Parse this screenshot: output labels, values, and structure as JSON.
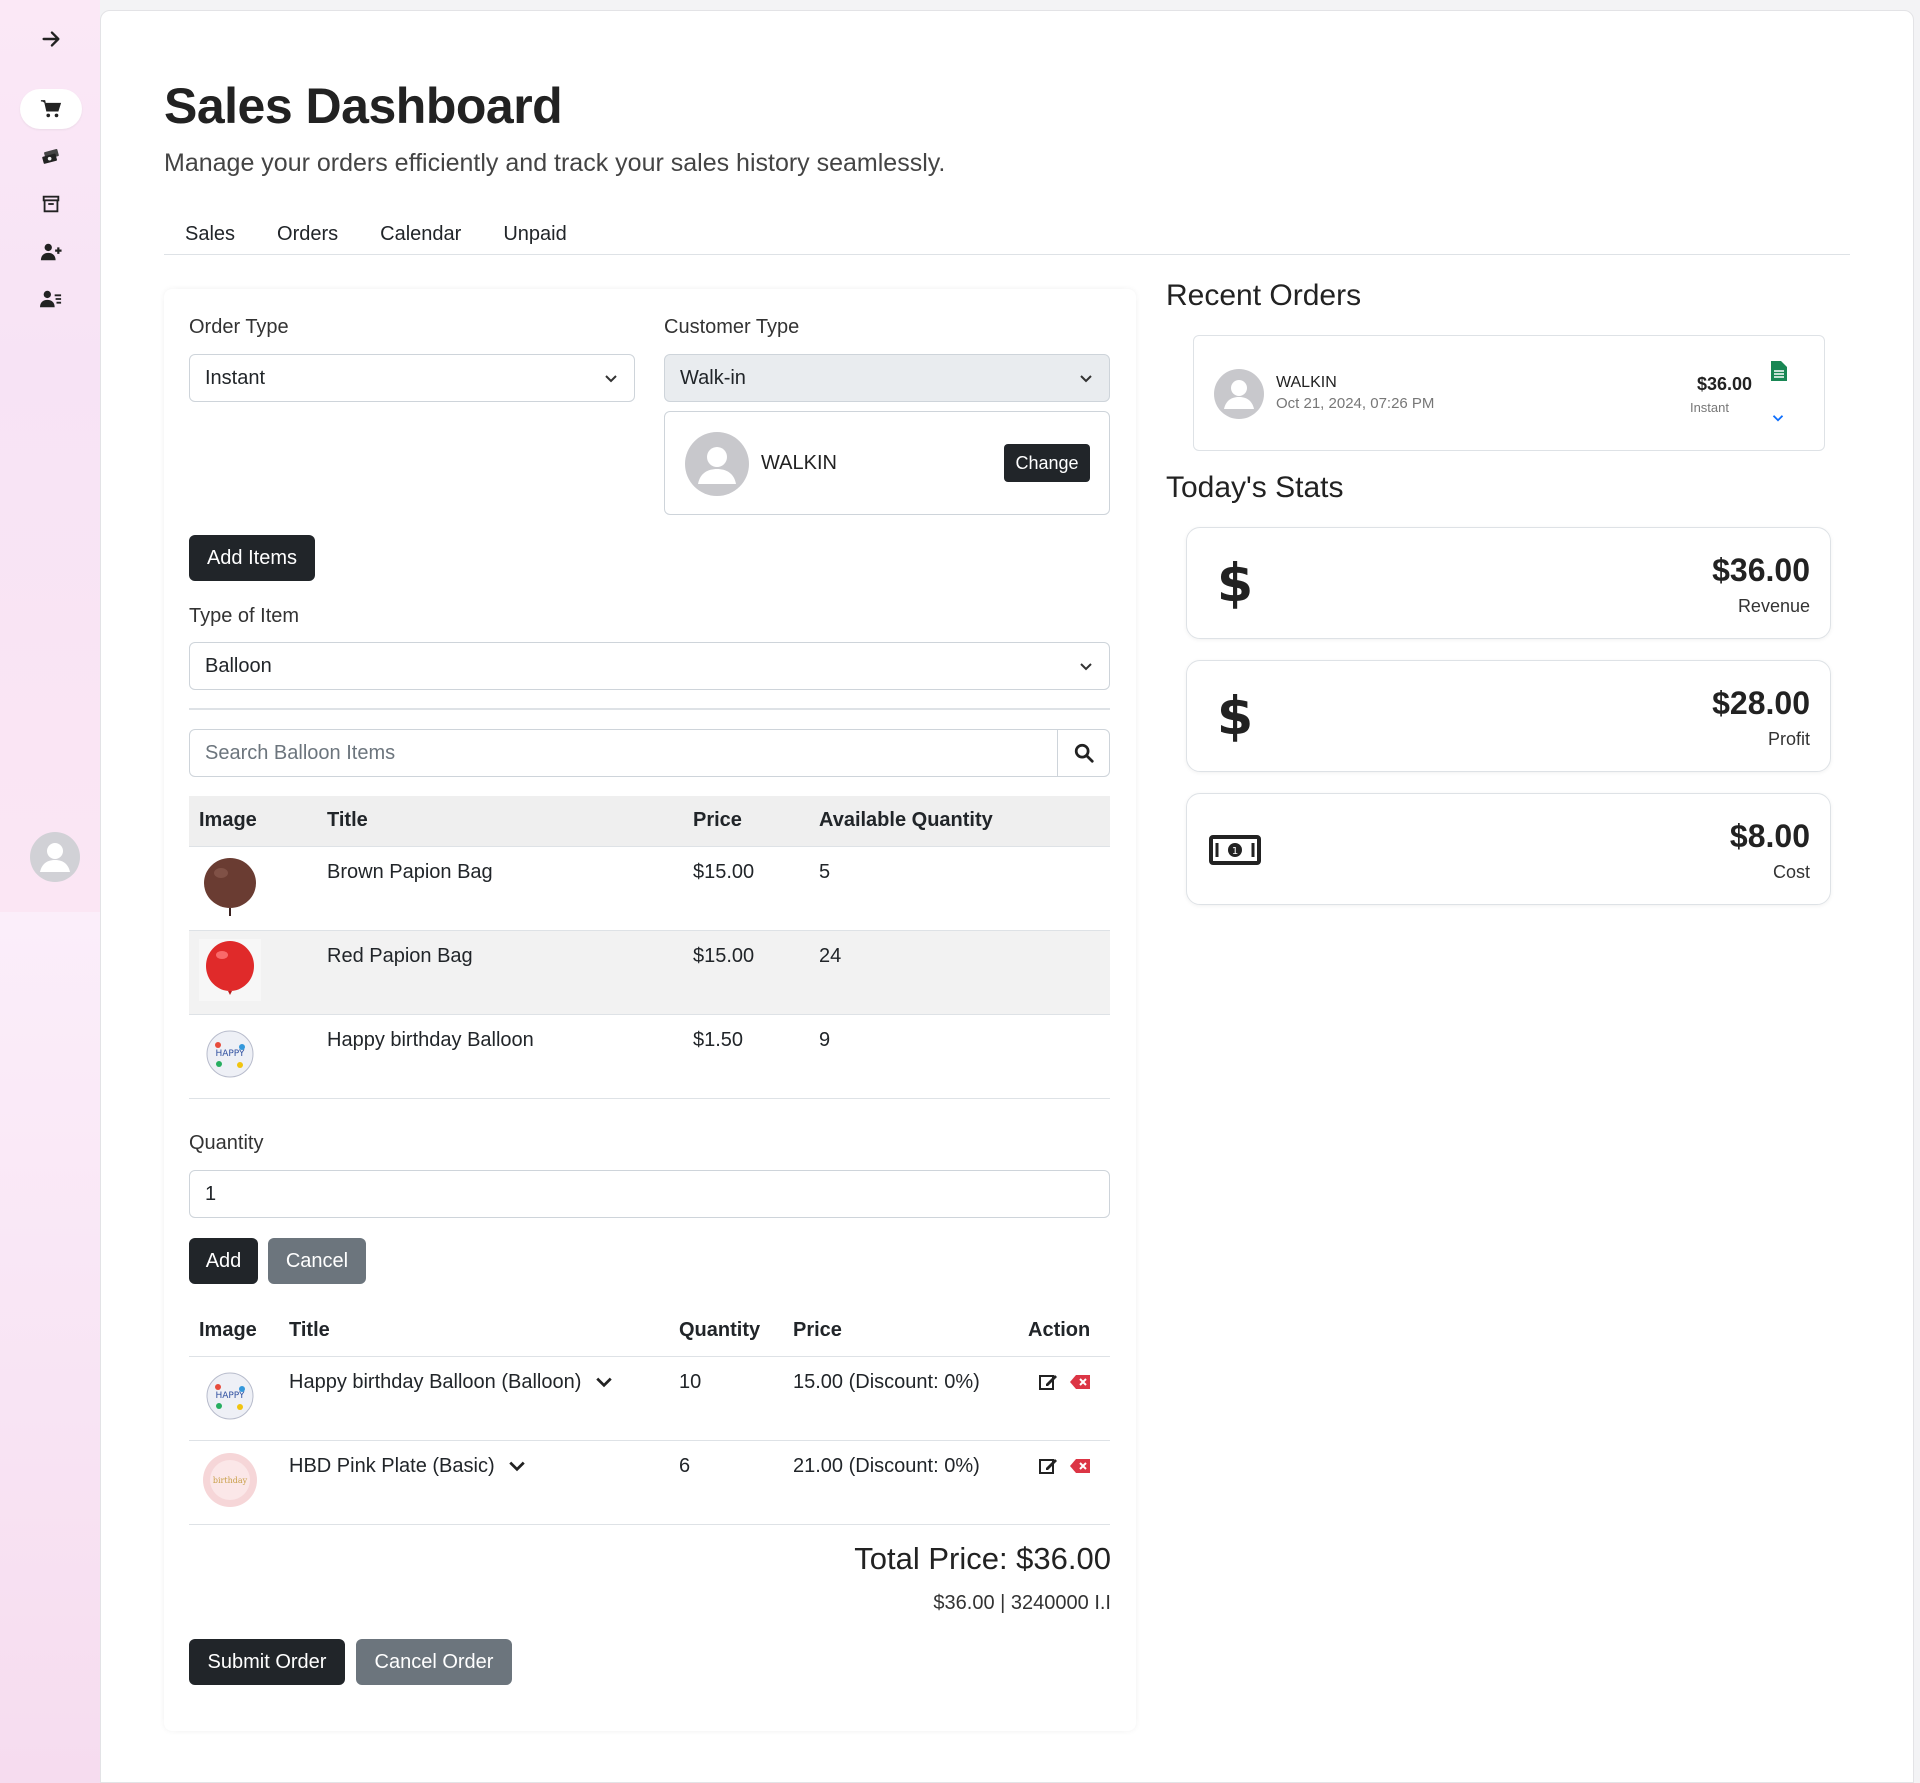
{
  "page": {
    "title": "Sales Dashboard",
    "subtitle": "Manage your orders efficiently and track your sales history seamlessly."
  },
  "sidebar": {
    "items": [
      {
        "icon": "arrow-right-icon"
      },
      {
        "icon": "cart-icon",
        "active": true
      },
      {
        "icon": "money-bills-icon"
      },
      {
        "icon": "archive-icon"
      },
      {
        "icon": "user-plus-icon"
      },
      {
        "icon": "user-list-icon"
      }
    ]
  },
  "tabs": [
    "Sales",
    "Orders",
    "Calendar",
    "Unpaid"
  ],
  "form": {
    "order_type_label": "Order Type",
    "order_type_value": "Instant",
    "customer_type_label": "Customer Type",
    "customer_type_value": "Walk-in",
    "customer_name": "WALKIN",
    "change_label": "Change",
    "add_items_label": "Add Items",
    "item_type_label": "Type of Item",
    "item_type_value": "Balloon",
    "search_placeholder": "Search Balloon Items",
    "quantity_label": "Quantity",
    "quantity_value": "1",
    "add_label": "Add",
    "cancel_label": "Cancel"
  },
  "items_table": {
    "headers": [
      "Image",
      "Title",
      "Price",
      "Available Quantity"
    ],
    "rows": [
      {
        "image": "brown-balloon",
        "title": "Brown Papion Bag",
        "price": "$15.00",
        "available": "5"
      },
      {
        "image": "red-balloon",
        "title": "Red Papion Bag",
        "price": "$15.00",
        "available": "24"
      },
      {
        "image": "happy-birthday-balloon",
        "title": "Happy birthday Balloon",
        "price": "$1.50",
        "available": "9"
      }
    ]
  },
  "cart_table": {
    "headers": [
      "Image",
      "Title",
      "Quantity",
      "Price",
      "Action"
    ],
    "rows": [
      {
        "image": "happy-birthday-balloon",
        "title": "Happy birthday Balloon (Balloon)",
        "quantity": "10",
        "price": "15.00 (Discount: 0%)"
      },
      {
        "image": "hbd-pink-plate",
        "title": "HBD Pink Plate (Basic)",
        "quantity": "6",
        "price": "21.00 (Discount: 0%)"
      }
    ]
  },
  "totals": {
    "total_price": "Total Price: $36.00",
    "total_sub": "$36.00 | 3240000 I.I"
  },
  "buttons": {
    "submit_order": "Submit Order",
    "cancel_order": "Cancel Order"
  },
  "recent_orders": {
    "title": "Recent Orders",
    "orders": [
      {
        "name": "WALKIN",
        "date": "Oct 21, 2024, 07:26 PM",
        "amount": "$36.00",
        "type": "Instant"
      }
    ]
  },
  "stats": {
    "title": "Today's Stats",
    "cards": [
      {
        "value": "$36.00",
        "label": "Revenue",
        "icon": "dollar-icon"
      },
      {
        "value": "$28.00",
        "label": "Profit",
        "icon": "dollar-icon"
      },
      {
        "value": "$8.00",
        "label": "Cost",
        "icon": "money-bill-icon"
      }
    ]
  },
  "colors": {
    "primary_button": "#212529",
    "secondary_button": "#6c757d",
    "invoice_icon": "#198754",
    "delete_icon": "#dc3545",
    "sidebar_bg": "#fbe8f6"
  }
}
